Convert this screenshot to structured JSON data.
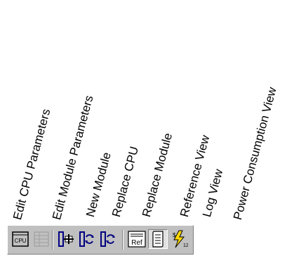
{
  "toolbar_items": [
    {
      "label": "Edit CPU Parameters",
      "icon": "cpu-icon",
      "enabled": true
    },
    {
      "label": "Edit Module Parameters",
      "icon": "module-params-icon",
      "enabled": false
    },
    {
      "label": "New Module",
      "icon": "new-module-icon",
      "enabled": true
    },
    {
      "label": "Replace CPU",
      "icon": "replace-cpu-icon",
      "enabled": true
    },
    {
      "label": "Replace Module",
      "icon": "replace-module-icon",
      "enabled": true
    },
    {
      "label": "Reference View",
      "icon": "reference-view-icon",
      "icon_text": "Ref",
      "enabled": true
    },
    {
      "label": "Log View",
      "icon": "log-view-icon",
      "enabled": true,
      "pressed": true
    },
    {
      "label": "Power Consumption View",
      "icon": "power-consumption-icon",
      "icon_text": "12",
      "enabled": true
    }
  ],
  "cpu_icon_text": "CPU",
  "colors": {
    "toolbar_bg": "#c0c0c0",
    "icon_blue": "#000080",
    "icon_yellow": "#ffd700"
  }
}
